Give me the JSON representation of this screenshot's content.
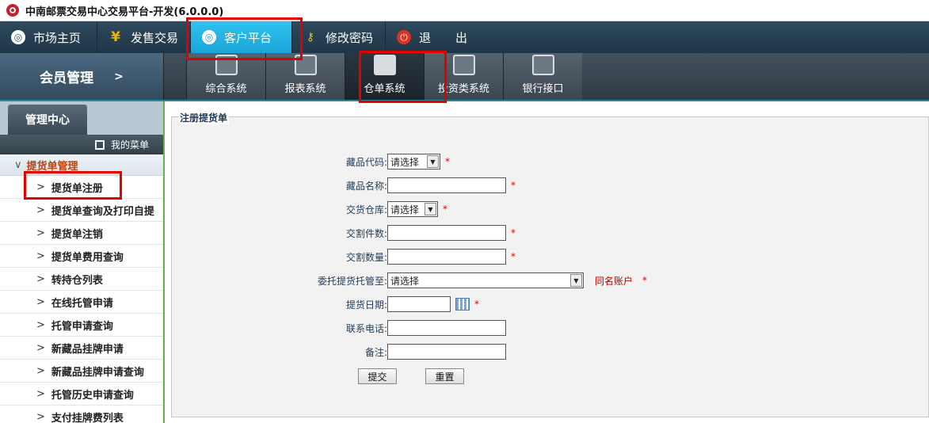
{
  "window": {
    "title": "中南邮票交易中心交易平台-开发(6.0.0.0)"
  },
  "topnav": {
    "items": [
      {
        "label": "市场主页",
        "icon": "market-icon"
      },
      {
        "label": "发售交易",
        "icon": "yen-icon"
      },
      {
        "label": "客户平台",
        "icon": "client-icon"
      },
      {
        "label": "修改密码",
        "icon": "key-icon"
      },
      {
        "label": "退",
        "icon": "power-icon"
      },
      {
        "label": "出",
        "icon": ""
      }
    ],
    "active": "客户平台"
  },
  "subnav": {
    "member_label": "会员管理",
    "member_arrow": ">",
    "tabs": [
      {
        "label": "综合系统"
      },
      {
        "label": "报表系统"
      },
      {
        "label": "仓单系统"
      },
      {
        "label": "投资类系统"
      },
      {
        "label": "银行接口"
      }
    ],
    "active": "仓单系统"
  },
  "sidebar": {
    "header": "管理中心",
    "my_menu": "我的菜单",
    "group": "提货单管理",
    "items": [
      "提货单注册",
      "提货单查询及打印自提",
      "提货单注销",
      "提货单费用查询",
      "转持仓列表",
      "在线托管申请",
      "托管申请查询",
      "新藏品挂牌申请",
      "新藏品挂牌申请查询",
      "托管历史申请查询",
      "支付挂牌费列表"
    ],
    "active": "提货单注册"
  },
  "form": {
    "legend": "注册提货单",
    "fields": {
      "code": {
        "label": "藏品代码:",
        "value": "请选择"
      },
      "name": {
        "label": "藏品名称:",
        "value": ""
      },
      "warehouse": {
        "label": "交货仓库:",
        "value": "请选择"
      },
      "pieces": {
        "label": "交割件数:",
        "value": ""
      },
      "quantity": {
        "label": "交割数量:",
        "value": ""
      },
      "custody": {
        "label": "委托提货托管至:",
        "value": "请选择",
        "hint": "同名账户"
      },
      "date": {
        "label": "提货日期:",
        "value": ""
      },
      "phone": {
        "label": "联系电话:",
        "value": ""
      },
      "remark": {
        "label": "备注:",
        "value": ""
      }
    },
    "required_mark": "*",
    "submit_label": "提交",
    "reset_label": "重置"
  },
  "colors": {
    "highlight": "#e00000",
    "nav_active": "#1aa4d8",
    "required": "#dd0000"
  }
}
